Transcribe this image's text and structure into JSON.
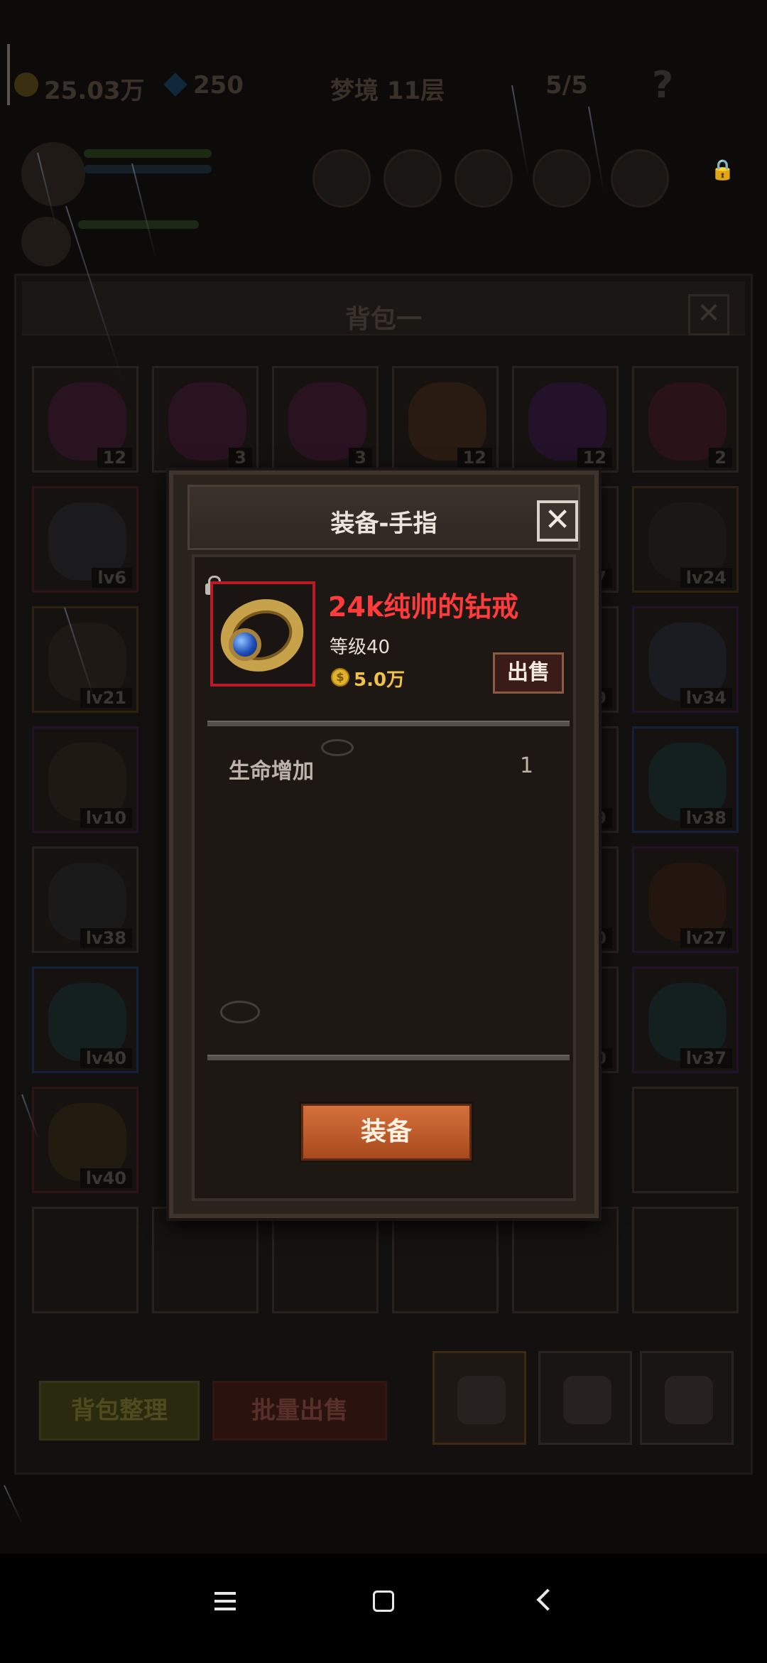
{
  "hud": {
    "gold": "25.03万",
    "gems": "250",
    "floor": "梦境 11层",
    "keys": "5/5",
    "help": "?"
  },
  "bag": {
    "title": "背包一",
    "close": "✕",
    "row1_counts": [
      "12",
      "3",
      "3",
      "12",
      "12",
      "2"
    ],
    "levels": {
      "r2c1": "lv6",
      "r2c5": "7",
      "r2c6": "lv24",
      "r3c1": "lv21",
      "r3c5": "9",
      "r3c6": "lv34",
      "r4c1": "lv10",
      "r4c5": "9",
      "r4c6": "lv38",
      "r5c1": "lv38",
      "r5c5": "0",
      "r5c6": "lv27",
      "r6c1": "lv40",
      "r6c5": "0",
      "r6c6": "lv37",
      "r7c1": "lv40"
    },
    "tidy_button": "背包整理",
    "sell_all_button": "批量出售"
  },
  "modal": {
    "title": "装备-手指",
    "close": "✕",
    "item": {
      "name": "24k纯帅的钻戒",
      "level": "等级40",
      "price": "5.0万",
      "name_color": "#ff3b3b"
    },
    "sell_button": "出售",
    "stats": [
      {
        "label": "生命增加",
        "value": "1"
      }
    ],
    "equip_button": "装备"
  },
  "icons": [
    "coin-icon",
    "gem-icon",
    "key-icon",
    "skull-icon",
    "help-icon",
    "lock-icon",
    "close-icon",
    "ring-icon",
    "backpack-icon",
    "menu-icon",
    "home-icon",
    "back-icon"
  ]
}
